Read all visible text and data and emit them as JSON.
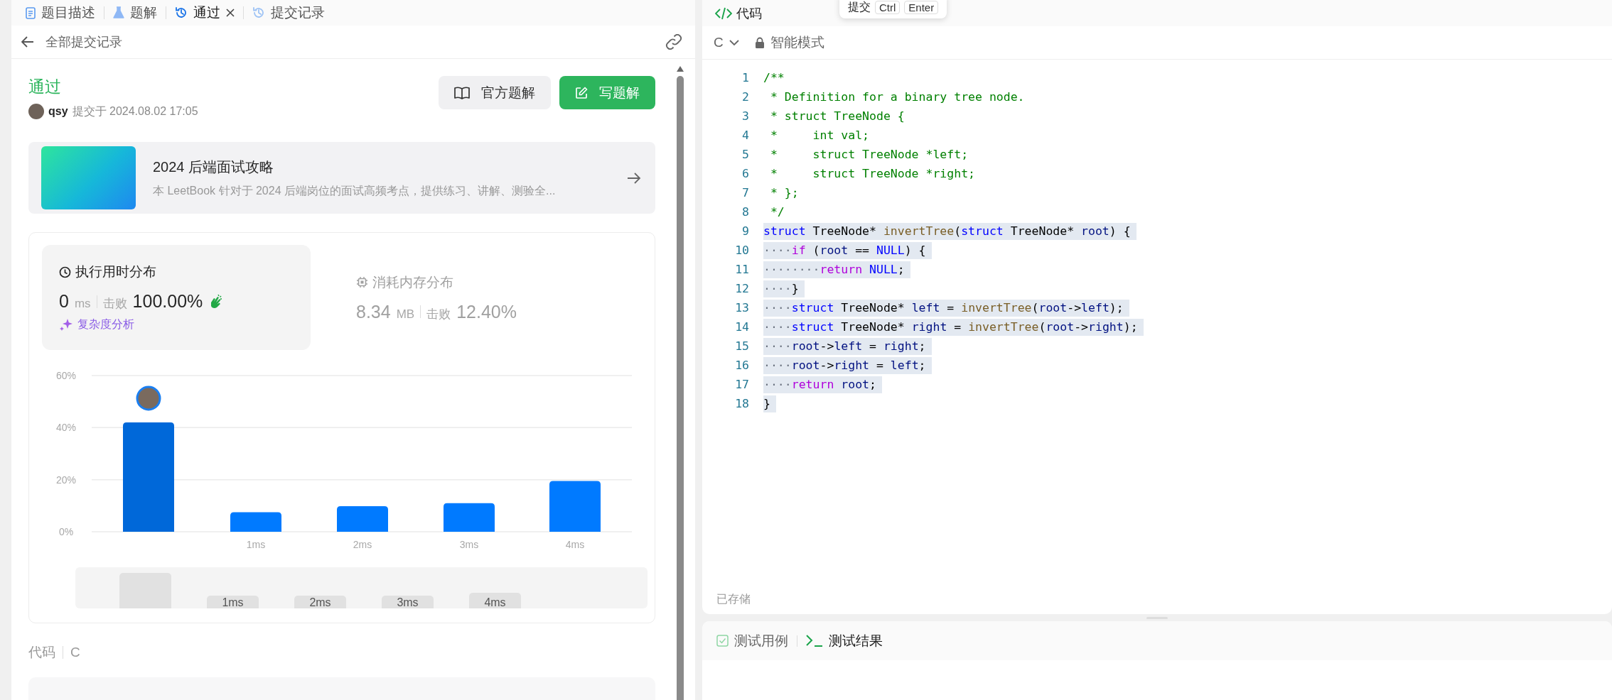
{
  "left_tabs": [
    {
      "label": "题目描述",
      "kind": "description",
      "selected": false,
      "closable": false
    },
    {
      "label": "题解",
      "kind": "solutions",
      "selected": false,
      "closable": false
    },
    {
      "label": "通过",
      "kind": "history",
      "selected": true,
      "closable": true
    },
    {
      "label": "提交记录",
      "kind": "history",
      "selected": false,
      "closable": false
    }
  ],
  "back_link": "全部提交记录",
  "submission": {
    "status": "通过",
    "user": "qsy",
    "submitted_at": "提交于 2024.08.02 17:05",
    "buttons": [
      {
        "label": "官方题解",
        "kind": "secondary"
      },
      {
        "label": "写题解",
        "kind": "primary"
      }
    ]
  },
  "book": {
    "title": "2024 后端面试攻略",
    "description": "本 LeetBook 针对于 2024 后端岗位的面试高频考点，提供练习、讲解、测验全..."
  },
  "stats": [
    {
      "kind": "runtime",
      "title": "执行用时分布",
      "value": "0",
      "unit": "ms",
      "beats_label": "击败",
      "beats": "100.00%",
      "link": "复杂度分析",
      "selected": true
    },
    {
      "kind": "memory",
      "title": "消耗内存分布",
      "value": "8.34",
      "unit": "MB",
      "beats_label": "击败",
      "beats": "12.40%",
      "selected": false
    }
  ],
  "chart": {
    "chart_data": {
      "type": "bar",
      "categories": [
        null,
        "1ms",
        "2ms",
        "3ms",
        "4ms"
      ],
      "series": [
        {
          "color": "#007aff",
          "values": [
            42,
            7.5,
            9.8,
            11,
            19.5
          ]
        }
      ],
      "ylim": [
        0,
        60
      ],
      "yticks": [
        {
          "value": 0,
          "label": "0%"
        },
        {
          "value": 20,
          "label": "20%"
        },
        {
          "value": 40,
          "label": "40%"
        },
        {
          "value": 60,
          "label": "60%"
        }
      ]
    },
    "bars": [
      {
        "selected": true
      },
      {
        "selected": false
      },
      {
        "selected": false
      },
      {
        "selected": false
      },
      {
        "selected": false
      }
    ],
    "navigator_labels": [
      "1ms",
      "2ms",
      "3ms",
      "4ms"
    ]
  },
  "code_section": {
    "label": "代码",
    "language": "C"
  },
  "editor": {
    "title": "代码",
    "shortcut_hint": {
      "action": "提交",
      "keys": [
        "Ctrl",
        "Enter"
      ]
    },
    "language": "C",
    "mode": "智能模式",
    "lines": [
      {
        "number": "1",
        "highlighted": false,
        "segments": [
          {
            "kind": "comment",
            "text": "/**"
          }
        ]
      },
      {
        "number": "2",
        "highlighted": false,
        "segments": [
          {
            "kind": "comment",
            "text": " * Definition for a binary tree node."
          }
        ]
      },
      {
        "number": "3",
        "highlighted": false,
        "segments": [
          {
            "kind": "comment",
            "text": " * struct TreeNode {"
          }
        ]
      },
      {
        "number": "4",
        "highlighted": false,
        "segments": [
          {
            "kind": "comment",
            "text": " *     int val;"
          }
        ]
      },
      {
        "number": "5",
        "highlighted": false,
        "segments": [
          {
            "kind": "comment",
            "text": " *     struct TreeNode *left;"
          }
        ]
      },
      {
        "number": "6",
        "highlighted": false,
        "segments": [
          {
            "kind": "comment",
            "text": " *     struct TreeNode *right;"
          }
        ]
      },
      {
        "number": "7",
        "highlighted": false,
        "segments": [
          {
            "kind": "comment",
            "text": " * };"
          }
        ]
      },
      {
        "number": "8",
        "highlighted": false,
        "segments": [
          {
            "kind": "comment",
            "text": " */"
          }
        ]
      },
      {
        "number": "9",
        "highlighted": true,
        "segments": [
          {
            "kind": "keyword",
            "text": "struct"
          },
          {
            "kind": "plain",
            "text": " TreeNode* "
          },
          {
            "kind": "function",
            "text": "invertTree"
          },
          {
            "kind": "plain",
            "text": "("
          },
          {
            "kind": "keyword",
            "text": "struct"
          },
          {
            "kind": "plain",
            "text": " TreeNode* "
          },
          {
            "kind": "variable",
            "text": "root"
          },
          {
            "kind": "plain",
            "text": ") {"
          }
        ]
      },
      {
        "number": "10",
        "highlighted": true,
        "segments": [
          {
            "kind": "whitespace",
            "text": "····"
          },
          {
            "kind": "control",
            "text": "if"
          },
          {
            "kind": "plain",
            "text": " ("
          },
          {
            "kind": "variable",
            "text": "root"
          },
          {
            "kind": "plain",
            "text": " == "
          },
          {
            "kind": "constant",
            "text": "NULL"
          },
          {
            "kind": "plain",
            "text": ") {"
          }
        ]
      },
      {
        "number": "11",
        "highlighted": true,
        "segments": [
          {
            "kind": "whitespace",
            "text": "········"
          },
          {
            "kind": "control",
            "text": "return"
          },
          {
            "kind": "constant",
            "text": " NULL"
          },
          {
            "kind": "plain",
            "text": ";"
          }
        ]
      },
      {
        "number": "12",
        "highlighted": true,
        "segments": [
          {
            "kind": "whitespace",
            "text": "····"
          },
          {
            "kind": "plain",
            "text": "}"
          }
        ]
      },
      {
        "number": "13",
        "highlighted": true,
        "segments": [
          {
            "kind": "whitespace",
            "text": "····"
          },
          {
            "kind": "keyword",
            "text": "struct"
          },
          {
            "kind": "plain",
            "text": " TreeNode* "
          },
          {
            "kind": "variable",
            "text": "left"
          },
          {
            "kind": "plain",
            "text": " = "
          },
          {
            "kind": "function",
            "text": "invertTree"
          },
          {
            "kind": "plain",
            "text": "("
          },
          {
            "kind": "variable",
            "text": "root"
          },
          {
            "kind": "plain",
            "text": "->"
          },
          {
            "kind": "variable",
            "text": "left"
          },
          {
            "kind": "plain",
            "text": ");"
          }
        ]
      },
      {
        "number": "14",
        "highlighted": true,
        "segments": [
          {
            "kind": "whitespace",
            "text": "····"
          },
          {
            "kind": "keyword",
            "text": "struct"
          },
          {
            "kind": "plain",
            "text": " TreeNode* "
          },
          {
            "kind": "variable",
            "text": "right"
          },
          {
            "kind": "plain",
            "text": " = "
          },
          {
            "kind": "function",
            "text": "invertTree"
          },
          {
            "kind": "plain",
            "text": "("
          },
          {
            "kind": "variable",
            "text": "root"
          },
          {
            "kind": "plain",
            "text": "->"
          },
          {
            "kind": "variable",
            "text": "right"
          },
          {
            "kind": "plain",
            "text": ");"
          }
        ]
      },
      {
        "number": "15",
        "highlighted": true,
        "segments": [
          {
            "kind": "whitespace",
            "text": "····"
          },
          {
            "kind": "variable",
            "text": "root"
          },
          {
            "kind": "plain",
            "text": "->"
          },
          {
            "kind": "variable",
            "text": "left"
          },
          {
            "kind": "plain",
            "text": " = "
          },
          {
            "kind": "variable",
            "text": "right"
          },
          {
            "kind": "plain",
            "text": ";"
          }
        ]
      },
      {
        "number": "16",
        "highlighted": true,
        "segments": [
          {
            "kind": "whitespace",
            "text": "····"
          },
          {
            "kind": "variable",
            "text": "root"
          },
          {
            "kind": "plain",
            "text": "->"
          },
          {
            "kind": "variable",
            "text": "right"
          },
          {
            "kind": "plain",
            "text": " = "
          },
          {
            "kind": "variable",
            "text": "left"
          },
          {
            "kind": "plain",
            "text": ";"
          }
        ]
      },
      {
        "number": "17",
        "highlighted": true,
        "segments": [
          {
            "kind": "whitespace",
            "text": "····"
          },
          {
            "kind": "control",
            "text": "return"
          },
          {
            "kind": "variable",
            "text": " root"
          },
          {
            "kind": "plain",
            "text": ";"
          }
        ]
      },
      {
        "number": "18",
        "highlighted": true,
        "segments": [
          {
            "kind": "plain",
            "text": "}"
          }
        ]
      }
    ],
    "save_status": "已存储"
  },
  "test_tabs": [
    {
      "label": "测试用例",
      "kind": "cases",
      "selected": false
    },
    {
      "label": "测试结果",
      "kind": "result",
      "selected": true
    }
  ]
}
